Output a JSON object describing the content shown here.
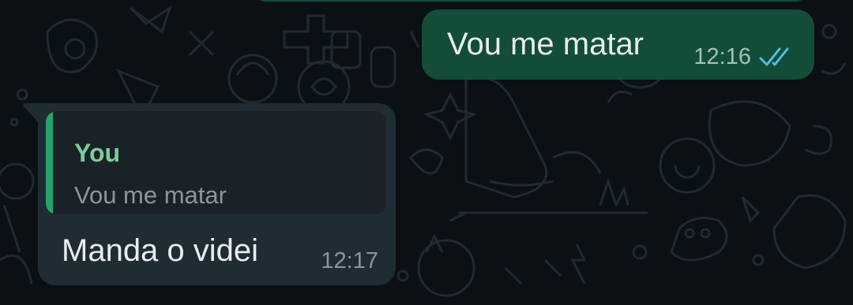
{
  "colors": {
    "background": "#0b1014",
    "outgoing_bubble": "#134d37",
    "incoming_bubble": "#202c33",
    "quote_bar": "#25a46a",
    "quote_author": "#7ccd97",
    "read_ticks": "#53bdeb"
  },
  "messages": [
    {
      "direction": "outgoing",
      "text": "Vou me matar",
      "time": "12:16",
      "status_icon": "double-check-read-icon"
    },
    {
      "direction": "incoming",
      "reply_to": {
        "author": "You",
        "text": "Vou me matar"
      },
      "text": "Manda o videi",
      "time": "12:17"
    }
  ]
}
